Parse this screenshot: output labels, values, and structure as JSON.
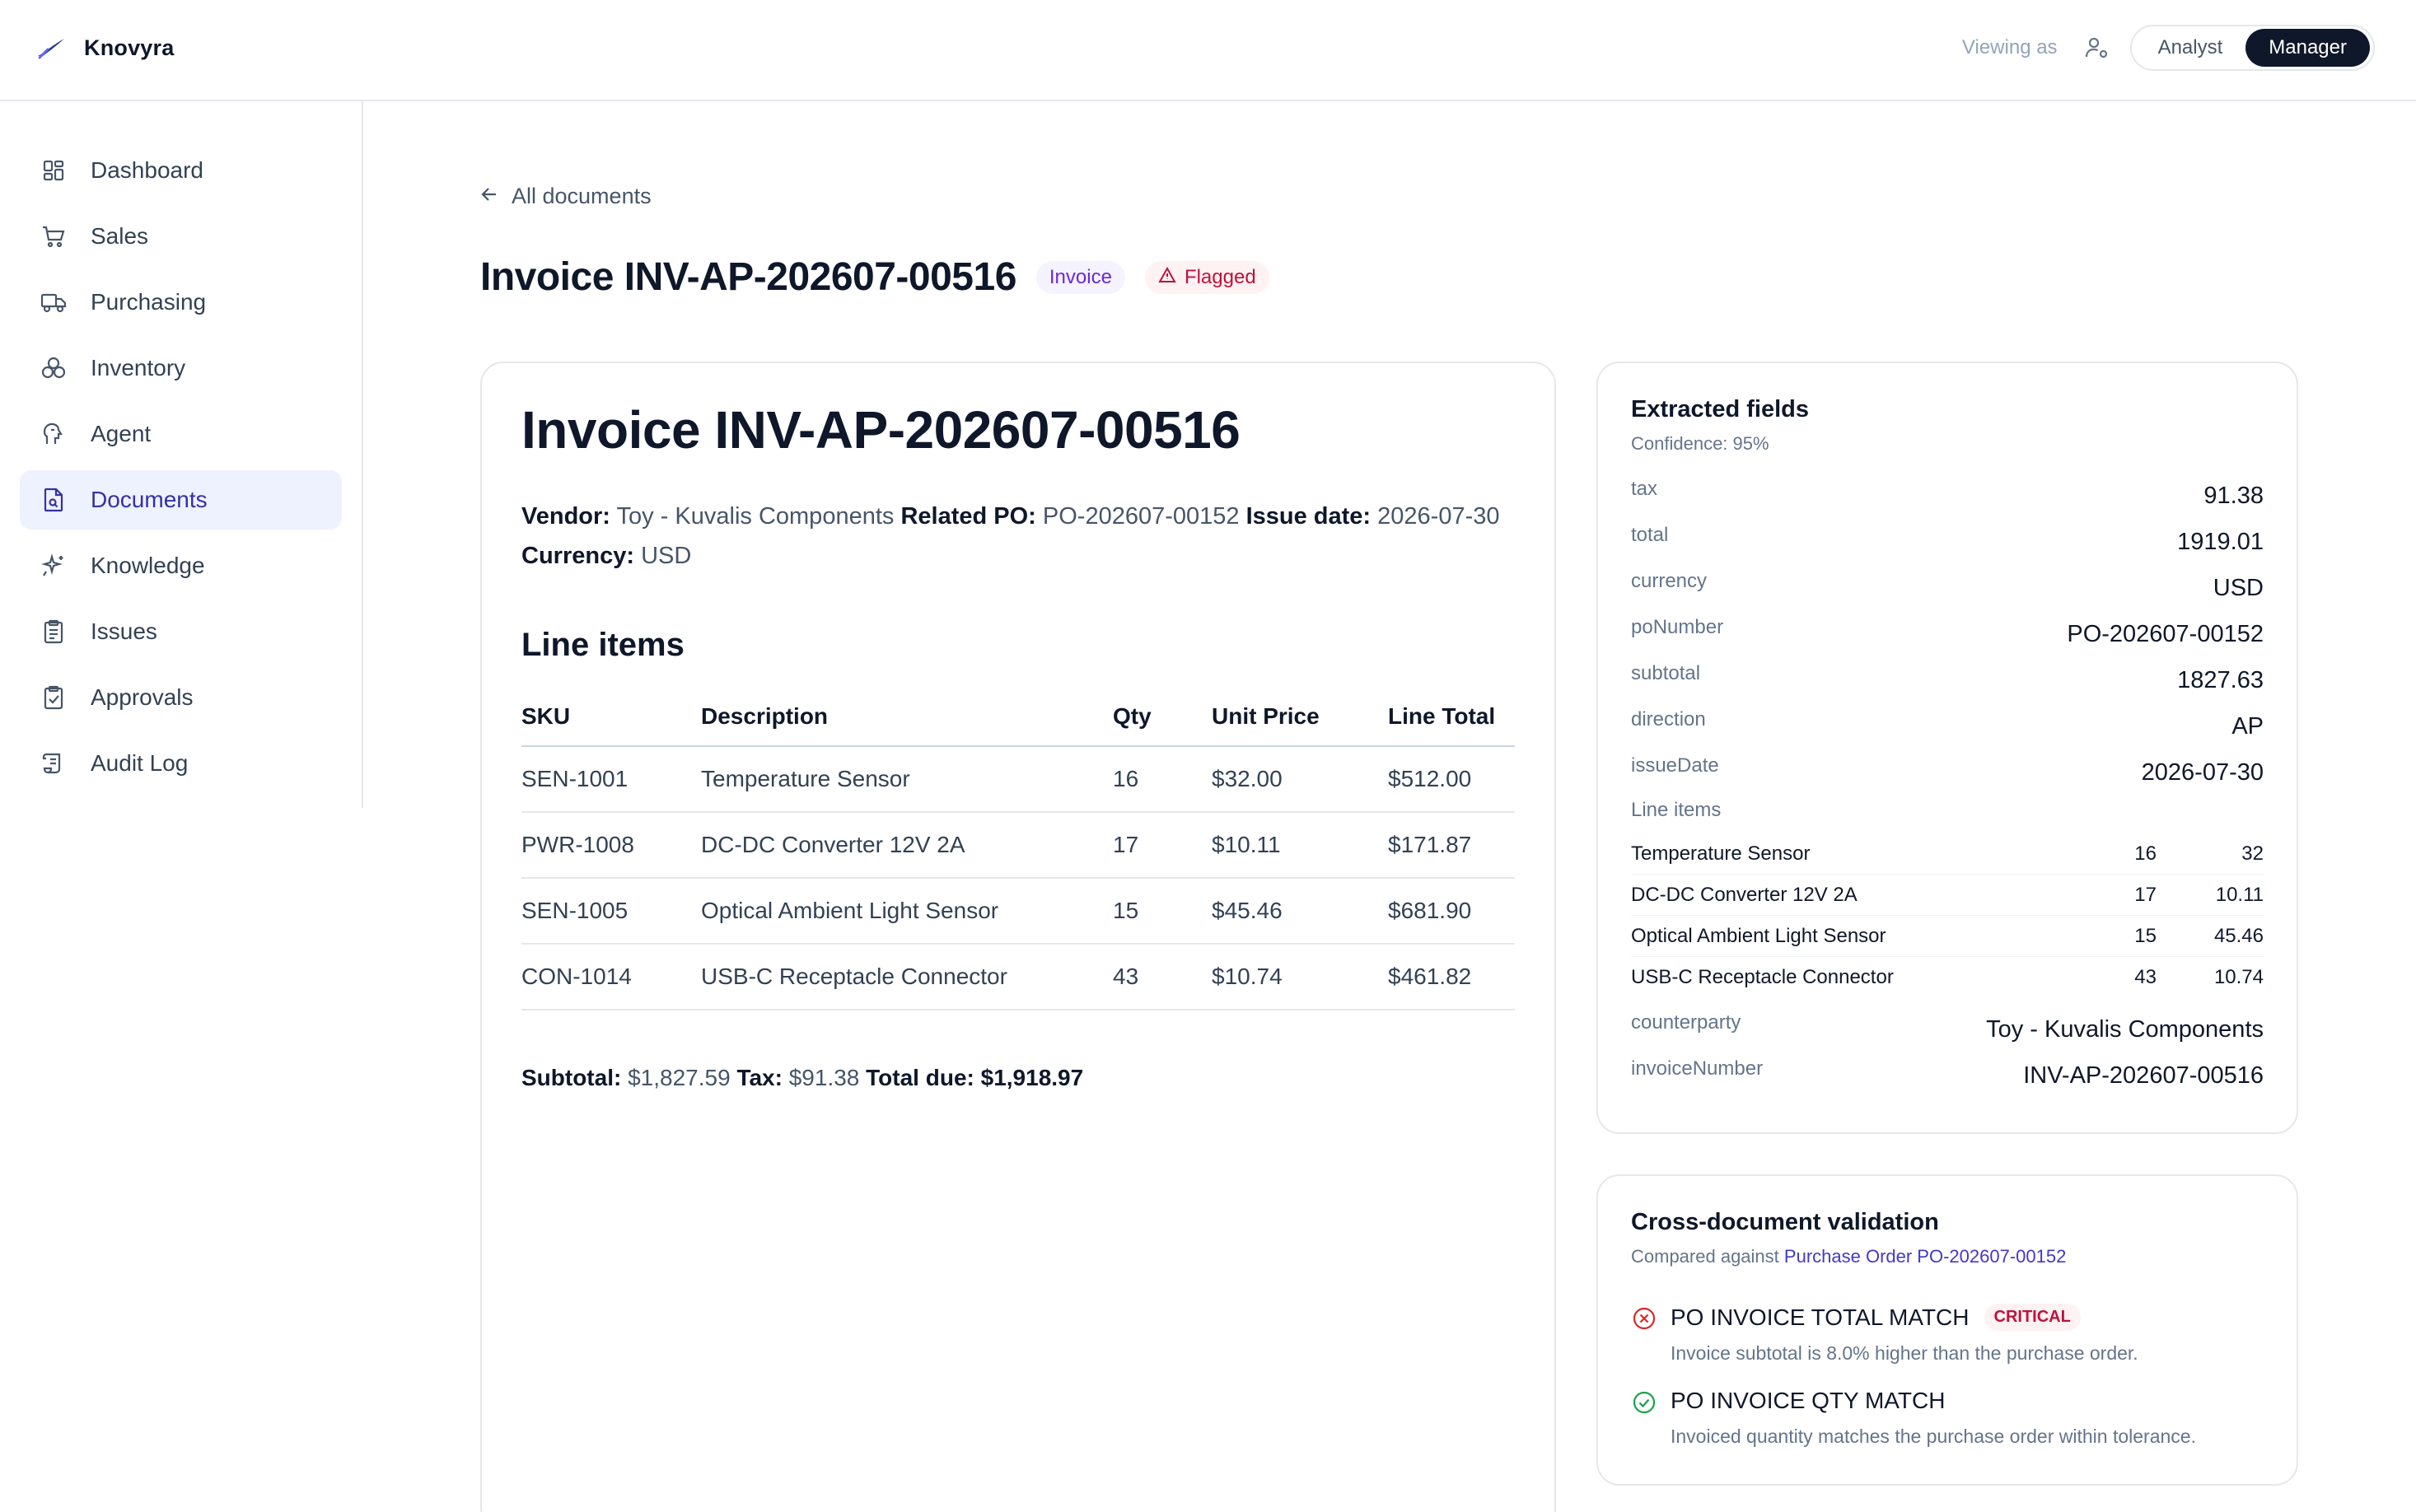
{
  "app": {
    "name": "Knovyra"
  },
  "header": {
    "viewing_label": "Viewing as",
    "roles": [
      "Analyst",
      "Manager"
    ],
    "active_role": "Manager"
  },
  "sidebar": {
    "items": [
      {
        "label": "Dashboard",
        "icon": "dashboard-icon"
      },
      {
        "label": "Sales",
        "icon": "cart-icon"
      },
      {
        "label": "Purchasing",
        "icon": "truck-icon"
      },
      {
        "label": "Inventory",
        "icon": "boxes-icon"
      },
      {
        "label": "Agent",
        "icon": "brain-icon"
      },
      {
        "label": "Documents",
        "icon": "document-search-icon",
        "active": true
      },
      {
        "label": "Knowledge",
        "icon": "sparkle-icon"
      },
      {
        "label": "Issues",
        "icon": "clipboard-list-icon"
      },
      {
        "label": "Approvals",
        "icon": "clipboard-check-icon"
      },
      {
        "label": "Audit Log",
        "icon": "scroll-icon"
      }
    ]
  },
  "page": {
    "back_label": "All documents",
    "title": "Invoice INV-AP-202607-00516",
    "type_badge": "Invoice",
    "flag_badge": "Flagged"
  },
  "document": {
    "heading": "Invoice INV-AP-202607-00516",
    "meta": {
      "vendor_label": "Vendor:",
      "vendor": "Toy - Kuvalis Components",
      "po_label": "Related PO:",
      "po": "PO-202607-00152",
      "issue_label": "Issue date:",
      "issue": "2026-07-30",
      "currency_label": "Currency:",
      "currency": "USD"
    },
    "line_items_heading": "Line items",
    "columns": [
      "SKU",
      "Description",
      "Qty",
      "Unit Price",
      "Line Total"
    ],
    "rows": [
      [
        "SEN-1001",
        "Temperature Sensor",
        "16",
        "$32.00",
        "$512.00"
      ],
      [
        "PWR-1008",
        "DC-DC Converter 12V 2A",
        "17",
        "$10.11",
        "$171.87"
      ],
      [
        "SEN-1005",
        "Optical Ambient Light Sensor",
        "15",
        "$45.46",
        "$681.90"
      ],
      [
        "CON-1014",
        "USB-C Receptacle Connector",
        "43",
        "$10.74",
        "$461.82"
      ]
    ],
    "totals": {
      "subtotal_label": "Subtotal:",
      "subtotal": "$1,827.59",
      "tax_label": "Tax:",
      "tax": "$91.38",
      "due_label": "Total due:",
      "due": "$1,918.97"
    }
  },
  "extracted": {
    "title": "Extracted fields",
    "confidence": "Confidence: 95%",
    "fields_top": [
      {
        "key": "tax",
        "value": "91.38"
      },
      {
        "key": "total",
        "value": "1919.01"
      },
      {
        "key": "currency",
        "value": "USD"
      },
      {
        "key": "poNumber",
        "value": "PO-202607-00152"
      },
      {
        "key": "subtotal",
        "value": "1827.63"
      },
      {
        "key": "direction",
        "value": "AP"
      },
      {
        "key": "issueDate",
        "value": "2026-07-30"
      }
    ],
    "line_items_label": "Line items",
    "line_items": [
      {
        "name": "Temperature Sensor",
        "qty": "16",
        "price": "32"
      },
      {
        "name": "DC-DC Converter 12V 2A",
        "qty": "17",
        "price": "10.11"
      },
      {
        "name": "Optical Ambient Light Sensor",
        "qty": "15",
        "price": "45.46"
      },
      {
        "name": "USB-C Receptacle Connector",
        "qty": "43",
        "price": "10.74"
      }
    ],
    "fields_bottom": [
      {
        "key": "counterparty",
        "value": "Toy - Kuvalis Components"
      },
      {
        "key": "invoiceNumber",
        "value": "INV-AP-202607-00516"
      }
    ]
  },
  "validation": {
    "title": "Cross-document validation",
    "compared_prefix": "Compared against",
    "compared_link": "Purchase Order PO-202607-00152",
    "checks": [
      {
        "title": "PO INVOICE TOTAL MATCH",
        "badge": "CRITICAL",
        "status": "fail",
        "desc": "Invoice subtotal is 8.0% higher than the purchase order."
      },
      {
        "title": "PO INVOICE QTY MATCH",
        "badge": "",
        "status": "pass",
        "desc": "Invoiced quantity matches the purchase order within tolerance."
      }
    ]
  },
  "colors": {
    "accent": "#4338ca",
    "danger": "#be123c",
    "success": "#16a34a",
    "dark": "#0f172a"
  }
}
